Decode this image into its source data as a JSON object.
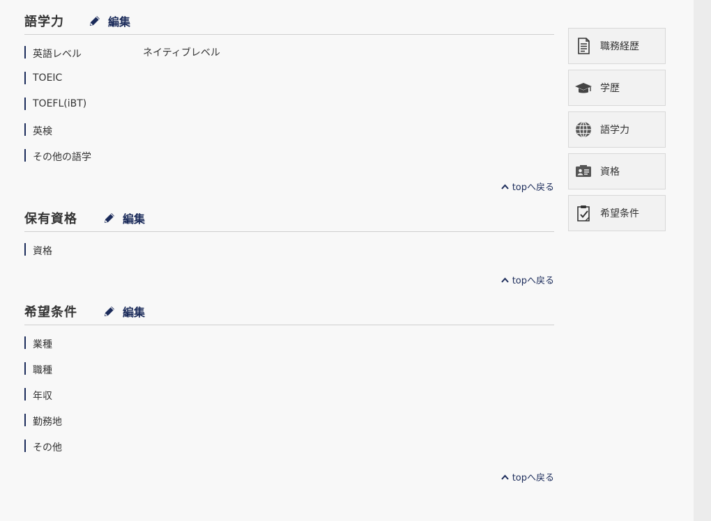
{
  "edit_label": "編集",
  "top_link_label": "topへ戻る",
  "sections": {
    "language": {
      "title": "語学力",
      "rows": [
        {
          "label": "英語レベル",
          "value": "ネイティブレベル"
        },
        {
          "label": "TOEIC",
          "value": ""
        },
        {
          "label": "TOEFL(iBT)",
          "value": ""
        },
        {
          "label": "英検",
          "value": ""
        },
        {
          "label": "その他の語学",
          "value": ""
        }
      ]
    },
    "qualifications": {
      "title": "保有資格",
      "rows": [
        {
          "label": "資格",
          "value": ""
        }
      ]
    },
    "preferences": {
      "title": "希望条件",
      "rows": [
        {
          "label": "業種",
          "value": ""
        },
        {
          "label": "職種",
          "value": ""
        },
        {
          "label": "年収",
          "value": ""
        },
        {
          "label": "勤務地",
          "value": ""
        },
        {
          "label": "その他",
          "value": ""
        }
      ]
    }
  },
  "side_nav": [
    {
      "label": "職務経歴",
      "icon": "document-icon"
    },
    {
      "label": "学歴",
      "icon": "graduation-cap-icon"
    },
    {
      "label": "語学力",
      "icon": "globe-icon"
    },
    {
      "label": "資格",
      "icon": "id-card-icon"
    },
    {
      "label": "希望条件",
      "icon": "clipboard-check-icon"
    }
  ],
  "colors": {
    "accent": "#1b2b5a",
    "background": "#f8f8f8",
    "divider": "#cfcfcf",
    "side_button_bg": "#f2f2f2",
    "text": "#333333"
  }
}
